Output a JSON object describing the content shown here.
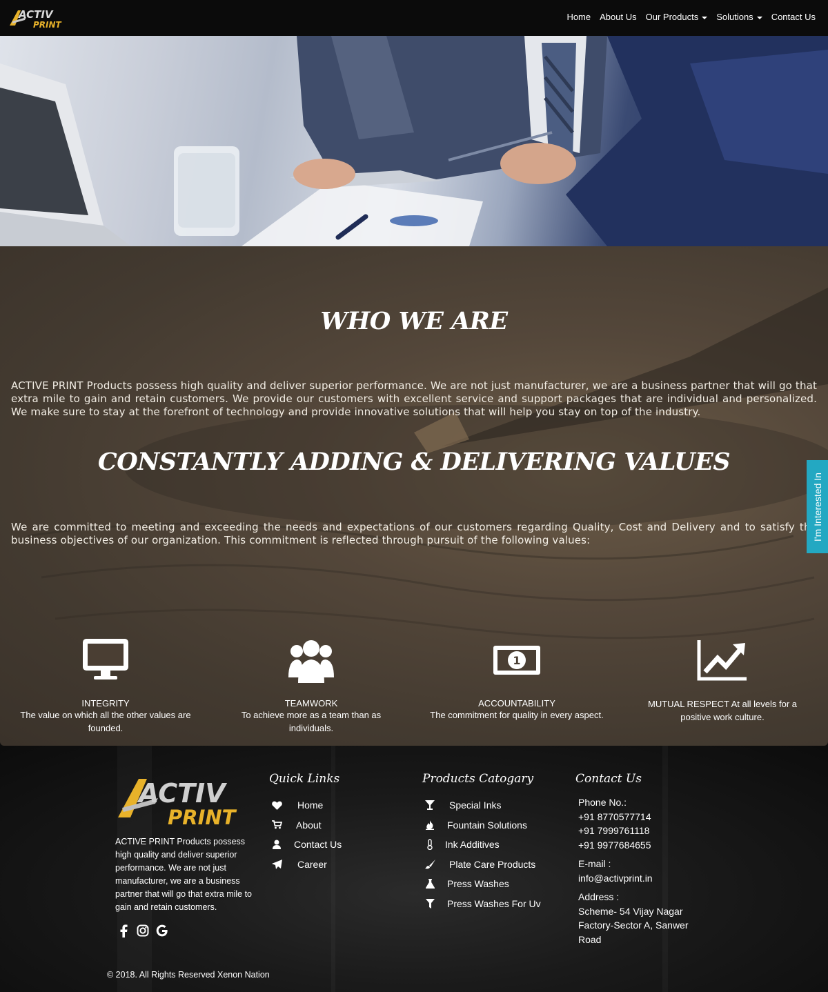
{
  "brand": {
    "logo_word1": "ACTIV",
    "logo_word2": "PRINT",
    "accent": "#e8b22a"
  },
  "nav": {
    "items": [
      {
        "label": "Home"
      },
      {
        "label": "About Us"
      },
      {
        "label": "Our Products"
      },
      {
        "label": "Solutions"
      },
      {
        "label": "Contact Us"
      }
    ]
  },
  "about": {
    "title": "WHO WE ARE",
    "paragraph": "ACTIVE PRINT Products possess high quality and deliver superior performance. We are not just manufacturer, we are a business partner that will go that extra mile to gain and retain customers. We provide our customers with excellent service and support packages that are individual and personalized. We make sure to stay at the forefront of technology and provide innovative solutions that will help you stay on top of the industry.",
    "title2": "CONSTANTLY ADDING & DELIVERING VALUES",
    "paragraph2": "We are committed to meeting and exceeding the needs and expectations of our customers regarding Quality, Cost and Delivery and to satisfy the business objectives of our organization. This commitment is reflected through pursuit of the following values:"
  },
  "values": [
    {
      "icon": "monitor-icon",
      "title": "INTEGRITY",
      "desc": "The value on which all the other values are founded."
    },
    {
      "icon": "team-icon",
      "title": "TEAMWORK",
      "desc": "To achieve more as a team than as individuals."
    },
    {
      "icon": "money-icon",
      "title": "ACCOUNTABILITY",
      "desc": "The commitment for quality in every aspect."
    },
    {
      "icon": "chart-line-icon",
      "title": "MUTUAL RESPECT At all levels for a positive work culture.",
      "desc": ""
    }
  ],
  "side_tab": {
    "label": "I'm Interested In",
    "color": "#23a8c2"
  },
  "footer": {
    "about": "ACTIVE PRINT Products possess high quality and deliver superior performance. We are not just manufacturer, we are a business partner that will go that extra mile to gain and retain customers.",
    "quick_links": {
      "title": "Quick Links",
      "items": [
        {
          "icon": "heart-icon",
          "label": "Home"
        },
        {
          "icon": "cart-icon",
          "label": "About"
        },
        {
          "icon": "user-icon",
          "label": "Contact Us"
        },
        {
          "icon": "paper-plane-icon",
          "label": "Career"
        }
      ]
    },
    "products": {
      "title": "Products Catogary",
      "items": [
        {
          "icon": "cocktail-icon",
          "label": "Special Inks"
        },
        {
          "icon": "fire-icon",
          "label": "Fountain Solutions"
        },
        {
          "icon": "thermometer-icon",
          "label": "Ink Additives"
        },
        {
          "icon": "brush-icon",
          "label": "Plate Care Products"
        },
        {
          "icon": "flask-icon",
          "label": "Press Washes"
        },
        {
          "icon": "filter-icon",
          "label": "Press Washes For Uv"
        }
      ]
    },
    "contact": {
      "title": "Contact Us",
      "phone_label": "Phone No.:",
      "phones": [
        "+91 8770577714",
        "+91 7999761118",
        "+91 9977684655"
      ],
      "email_label": "E-mail :",
      "email": "info@activprint.in",
      "address_label": "Address :",
      "address": "Scheme- 54 Vijay Nagar Factory-Sector A, Sanwer Road"
    },
    "social": [
      "facebook-icon",
      "instagram-icon",
      "google-icon"
    ],
    "copyright": "© 2018. All Rights Reserved Xenon Nation"
  }
}
